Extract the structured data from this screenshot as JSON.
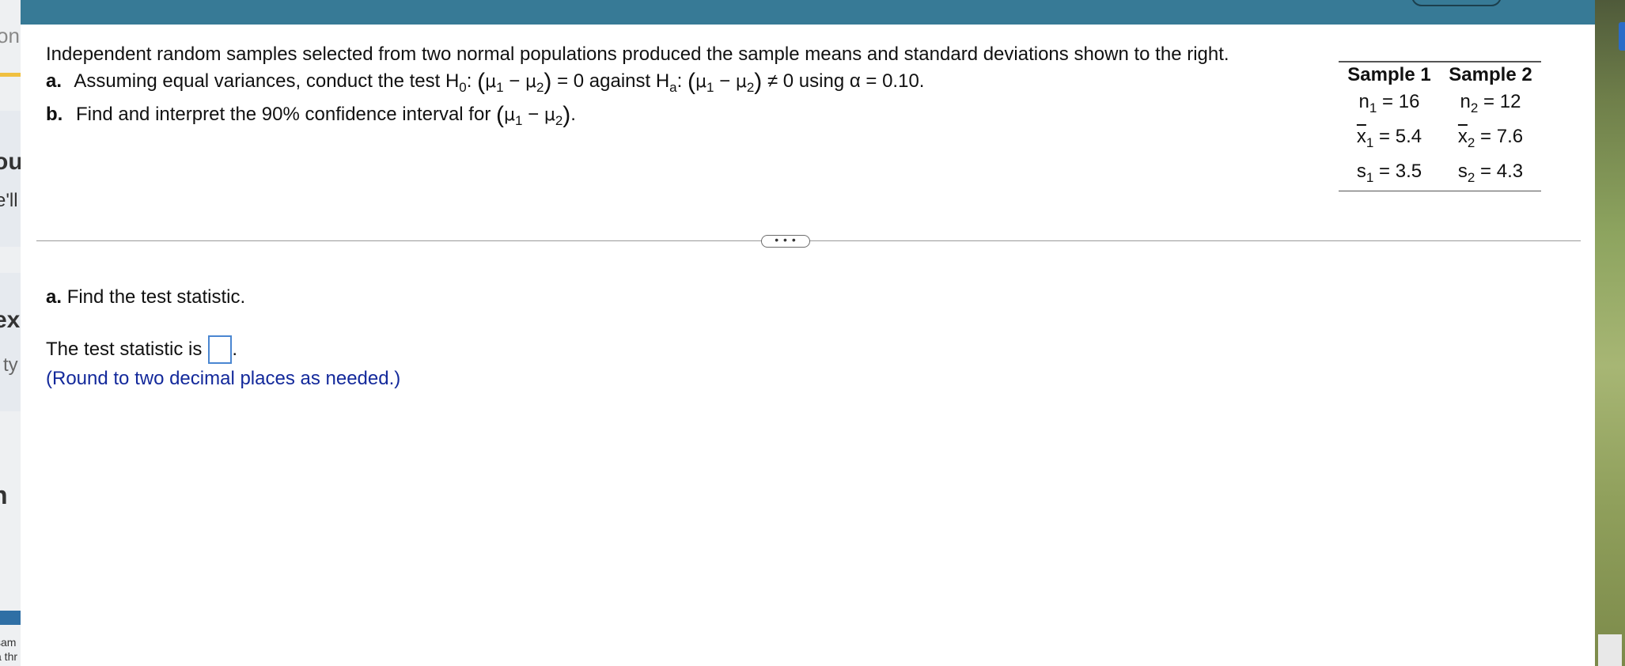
{
  "left_pane": {
    "fragments": [
      "on",
      "ou",
      "e'll",
      "ex",
      "ty",
      "n",
      "sam",
      "a thr"
    ]
  },
  "question": {
    "intro": "Independent random samples selected from two normal populations produced the sample means and standard deviations shown to the right.",
    "a_label": "a.",
    "a_text_1": "Assuming equal variances, conduct the test H",
    "a_h0_sub": "0",
    "a_text_2": "= 0 against H",
    "a_ha_sub": "a",
    "a_text_3": "≠ 0 using α = 0.10.",
    "b_label": "b.",
    "b_text": "Find and interpret the 90% confidence interval for",
    "mu": "μ",
    "minus": "−",
    "sub1": "1",
    "sub2": "2",
    "colon": ":"
  },
  "table": {
    "headers": [
      "Sample 1",
      "Sample 2"
    ],
    "rows": [
      [
        {
          "sym": "n",
          "sub": "1",
          "val": "= 16"
        },
        {
          "sym": "n",
          "sub": "2",
          "val": "= 12"
        }
      ],
      [
        {
          "sym": "x",
          "sub": "1",
          "val": "= 5.4"
        },
        {
          "sym": "x",
          "sub": "2",
          "val": "= 7.6"
        }
      ],
      [
        {
          "sym": "s",
          "sub": "1",
          "val": "= 3.5"
        },
        {
          "sym": "s",
          "sub": "2",
          "val": "= 4.3"
        }
      ]
    ]
  },
  "more_button": "• • •",
  "part_a": {
    "label": "a.",
    "prompt": "Find the test statistic.",
    "answer_prefix": "The test statistic is",
    "answer_suffix": ".",
    "hint": "(Round to two decimal places as needed.)",
    "answer_value": ""
  },
  "colors": {
    "topbar": "#377a96",
    "hint": "#13299b",
    "answer_box_border": "#4a86d1"
  }
}
